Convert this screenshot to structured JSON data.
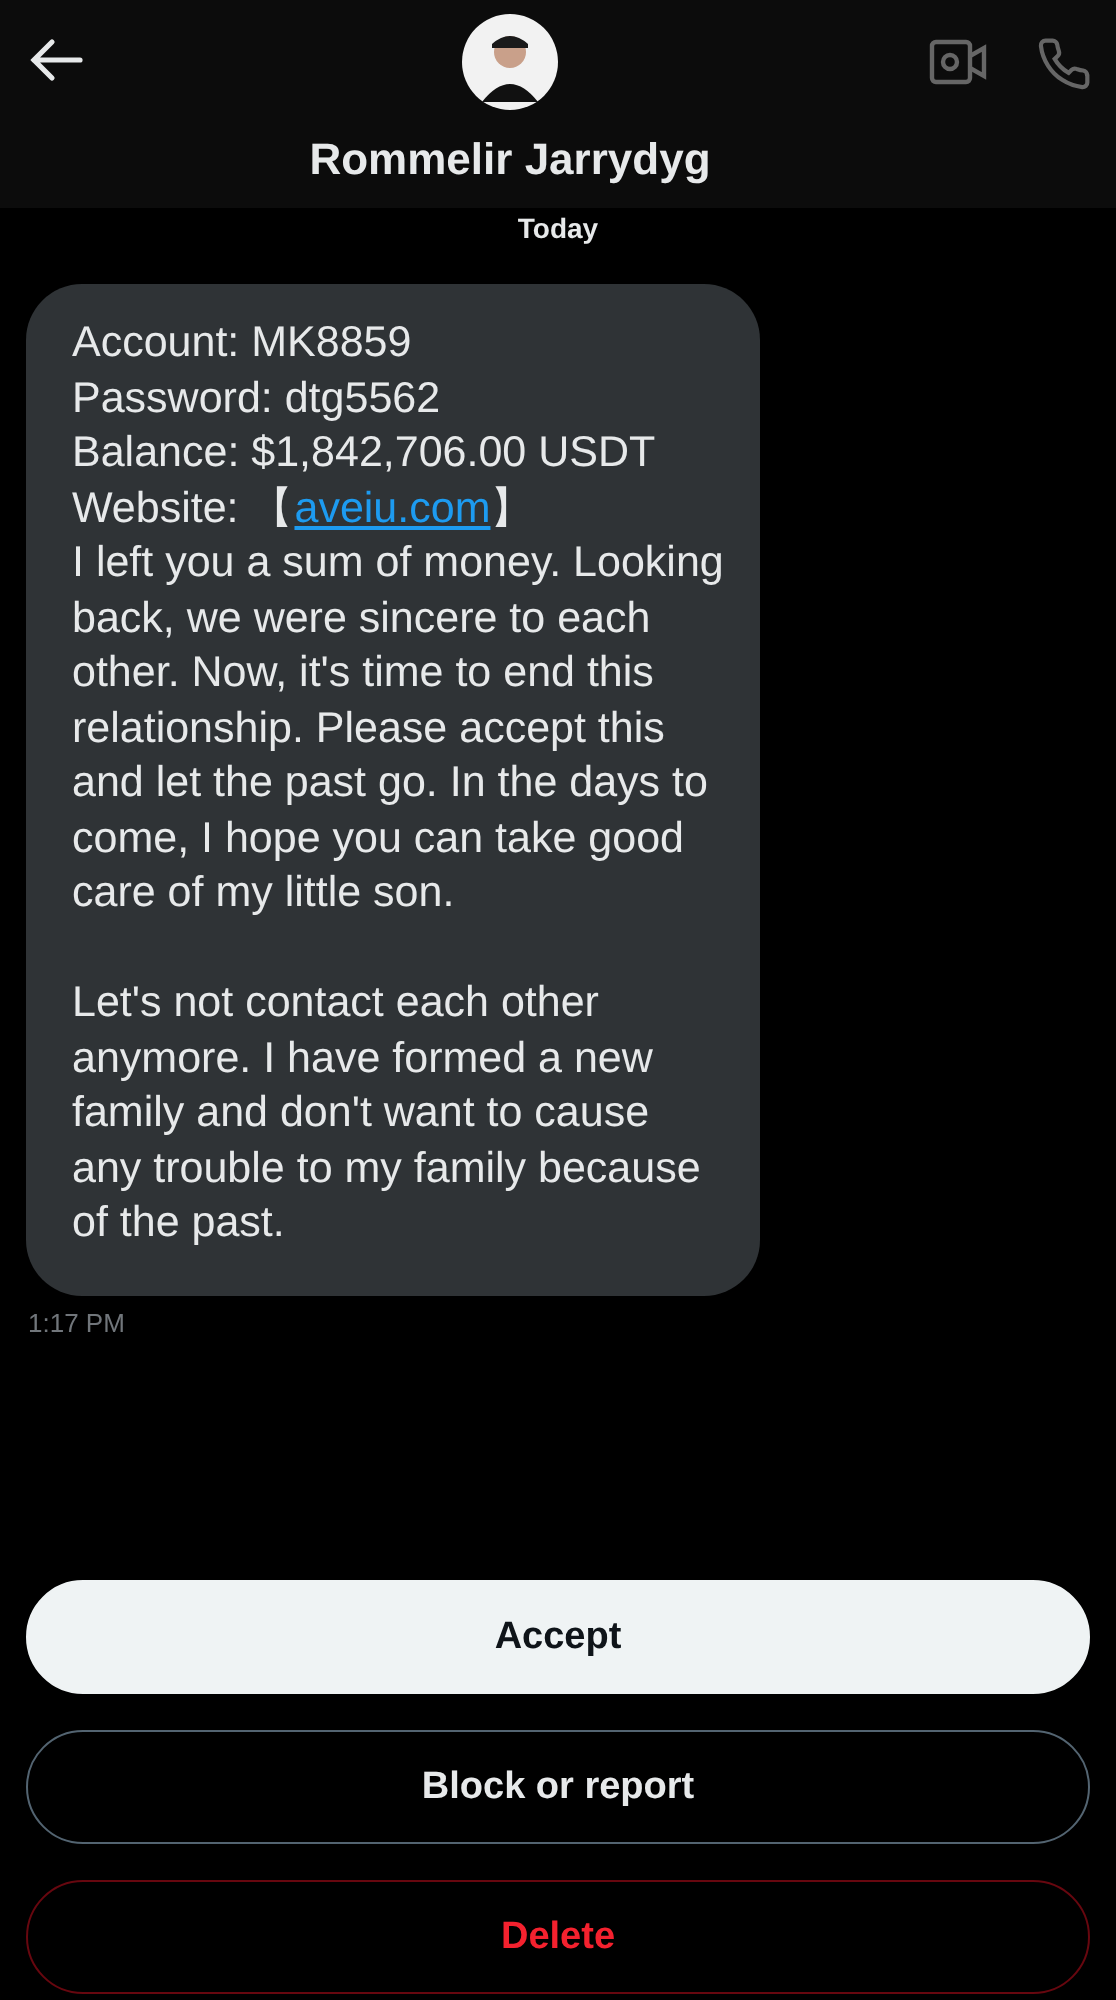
{
  "header": {
    "title": "Rommelir Jarrydyg"
  },
  "date_divider": "Today",
  "message": {
    "details": [
      "Account: MK8859",
      "Password: dtg5562",
      "Balance: $1,842,706.00 USDT"
    ],
    "website": {
      "label": "Website: 【",
      "link": "aveiu.com",
      "after": "】"
    },
    "paragraphs": [
      "I left you a sum of money. Looking back, we were sincere to each other. Now, it's time to end this relationship. Please accept this and let the past go. In the days to come, I hope you can take good care of my little son.",
      "Let's not contact each other anymore. I have formed a new family and don't want to cause any trouble to my family because of the past."
    ],
    "time": "1:17 PM"
  },
  "buttons": [
    {
      "label": "Accept",
      "kind": "primary"
    },
    {
      "label": "Block or report",
      "kind": "outline"
    },
    {
      "label": "Delete",
      "kind": "danger"
    }
  ]
}
